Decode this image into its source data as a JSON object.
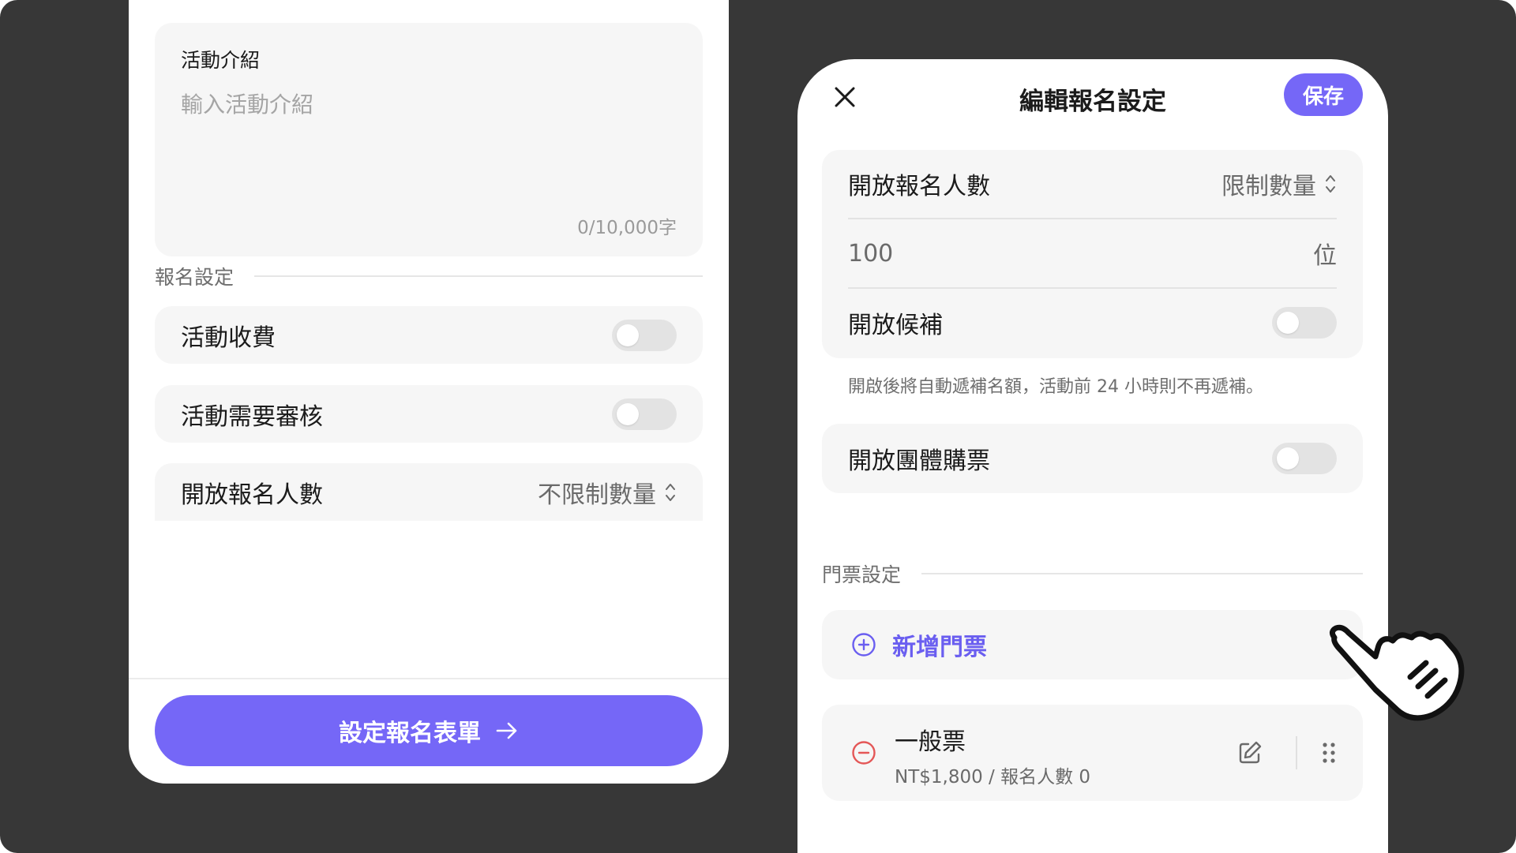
{
  "left_screen": {
    "intro": {
      "label": "活動介紹",
      "placeholder": "輸入活動介紹",
      "counter": "0/10,000字"
    },
    "section_title": "報名設定",
    "rows": {
      "fee_label": "活動收費",
      "fee_on": false,
      "review_label": "活動需要審核",
      "review_on": false,
      "capacity_label": "開放報名人數",
      "capacity_value": "不限制數量"
    },
    "primary_button": "設定報名表單"
  },
  "right_screen": {
    "title": "編輯報名設定",
    "save_label": "保存",
    "capacity": {
      "label": "開放報名人數",
      "value": "限制數量",
      "number": "100",
      "unit": "位",
      "waitlist_label": "開放候補",
      "waitlist_on": false
    },
    "waitlist_hint": "開啟後將自動遞補名額，活動前 24 小時則不再遞補。",
    "group_label": "開放團體購票",
    "group_on": false,
    "tickets_section": "門票設定",
    "add_ticket": "新增門票",
    "tickets": [
      {
        "name": "一般票",
        "meta": "NT$1,800 / 報名人數 0"
      }
    ]
  },
  "colors": {
    "accent": "#7567f7",
    "accent_text": "#6a5ef0",
    "remove": "#e45757",
    "card_bg": "#f6f6f6",
    "backdrop": "#373737"
  },
  "icons": [
    "close-icon",
    "chevron-updown-icon",
    "arrow-right-icon",
    "plus-circle-icon",
    "minus-circle-icon",
    "edit-icon",
    "drag-handle-icon",
    "pointer-hand-icon"
  ]
}
